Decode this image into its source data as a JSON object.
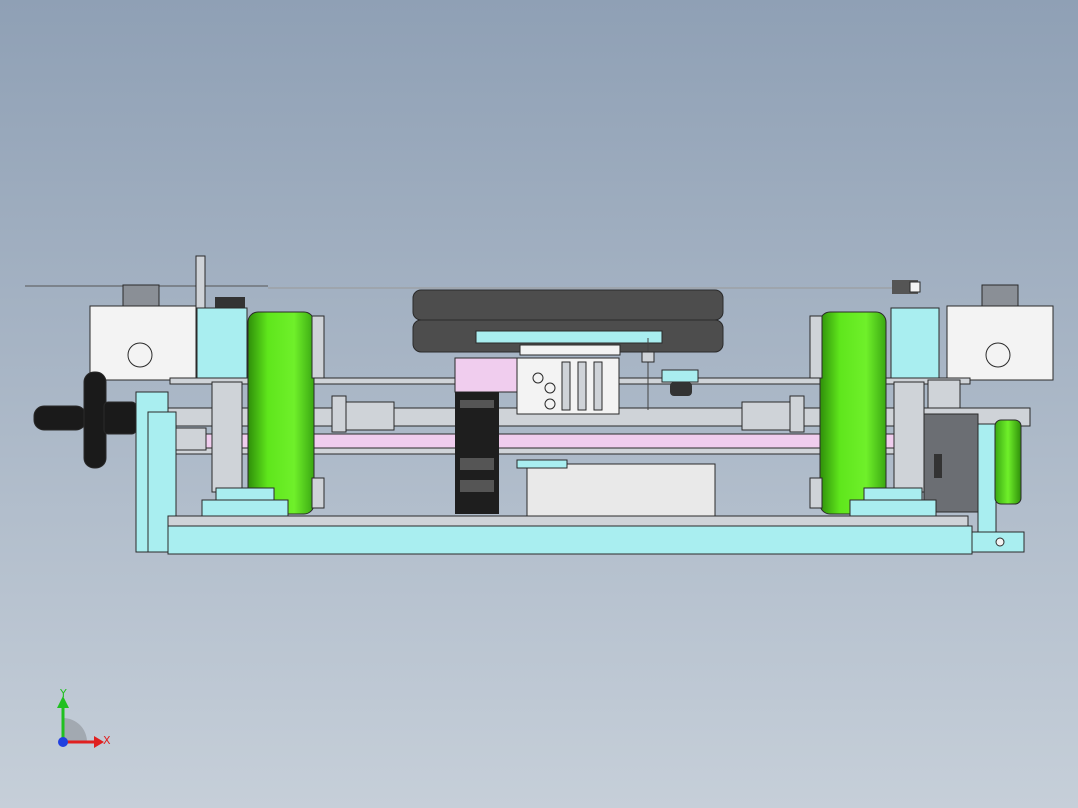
{
  "viewport": {
    "background_top": "#8fa0b5",
    "background_bottom": "#c6cfd9"
  },
  "model": {
    "colors": {
      "frame_cyan": "#a9eef0",
      "roller_green": "#5fe61c",
      "roller_green_dark": "#2f8f0a",
      "belt_dark": "#4d4d4d",
      "housing_white": "#f3f3f3",
      "motor_grey": "#8a8f96",
      "pink_rail": "#f0cdee",
      "shaft_grey": "#cfd3d8",
      "handwheel_black": "#1a1a1a",
      "outline": "#2a2a2a"
    }
  },
  "triad": {
    "x_label": "X",
    "y_label": "Y",
    "x_color": "#e02020",
    "y_color": "#20c020",
    "z_color": "#2040e0"
  }
}
